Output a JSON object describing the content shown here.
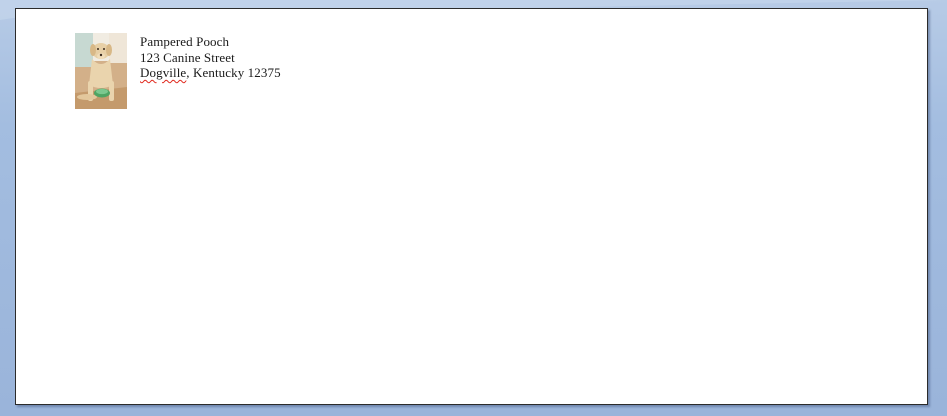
{
  "envelope": {
    "logo_icon": "dog-photo",
    "return_address": {
      "line1": "Pampered  Pooch",
      "line2": "123 Canine  Street",
      "line3_city": "Dogville",
      "line3_rest": ", Kentucky  12375"
    }
  },
  "colors": {
    "workspace": "#a3bde0",
    "page": "#ffffff",
    "spell_underline": "#e0261b"
  }
}
